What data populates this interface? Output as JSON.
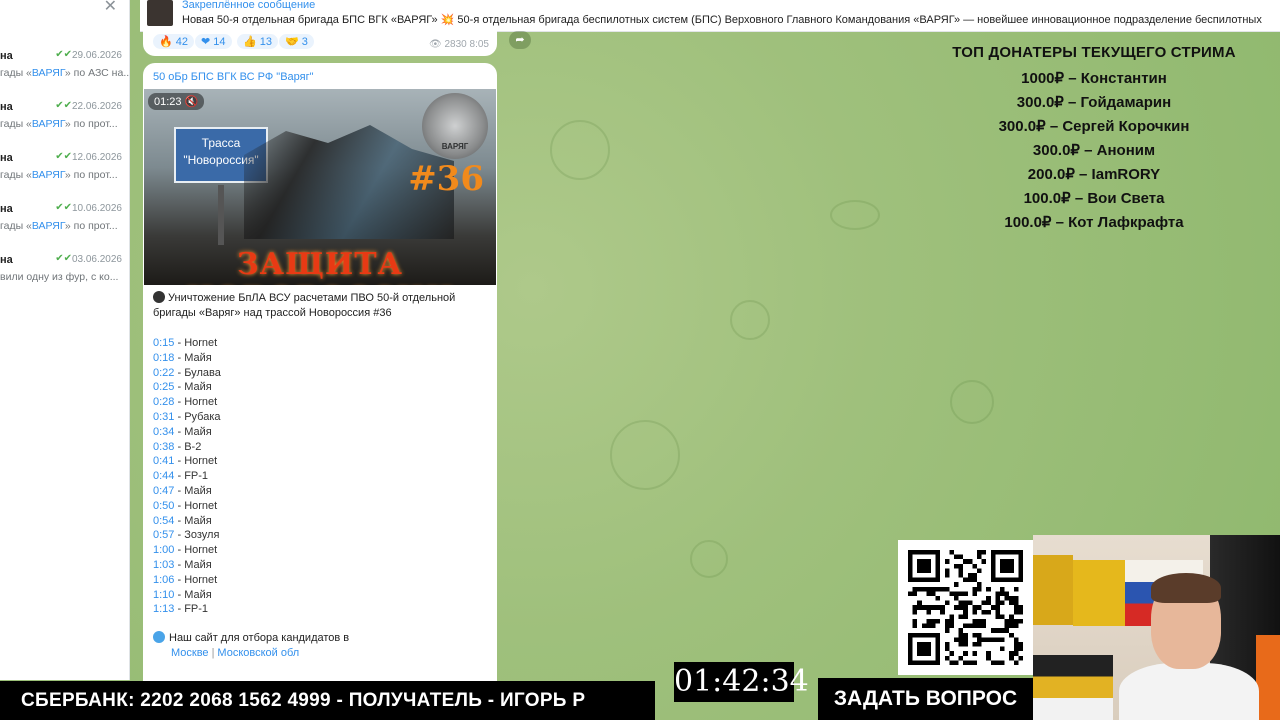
{
  "chat_list": {
    "items": [
      {
        "name": "на",
        "date": "29.06.2026",
        "preview_prefix": "гады «",
        "preview_link": "ВАРЯГ",
        "preview_suffix": "» по АЗС на..."
      },
      {
        "name": "на",
        "date": "22.06.2026",
        "preview_prefix": "гады «",
        "preview_link": "ВАРЯГ",
        "preview_suffix": "» по прот..."
      },
      {
        "name": "на",
        "date": "12.06.2026",
        "preview_prefix": "гады «",
        "preview_link": "ВАРЯГ",
        "preview_suffix": "» по прот..."
      },
      {
        "name": "на",
        "date": "10.06.2026",
        "preview_prefix": "гады «",
        "preview_link": "ВАРЯГ",
        "preview_suffix": "» по прот..."
      },
      {
        "name": "на",
        "date": "03.06.2026",
        "preview_prefix": "вили одну из фур, с ко...",
        "preview_link": "",
        "preview_suffix": ""
      }
    ]
  },
  "pinned": {
    "title": "Закреплённое сообщение",
    "text": "Новая 50-я отдельная бригада БПС ВГК «ВАРЯГ» 💥 50-я отдельная бригада беспилотных систем (БПС) Верховного Главного Командования «ВАРЯГ» — новейшее инновационное подразделение беспилотных"
  },
  "top_reactions": [
    {
      "emoji": "🔥",
      "count": "42"
    },
    {
      "emoji": "❤",
      "count": "14"
    },
    {
      "emoji": "👍",
      "count": "13"
    },
    {
      "emoji": "🤝",
      "count": "3"
    }
  ],
  "top_views": "2830",
  "top_time": "8:05",
  "message": {
    "channel": "50 оБр БПС ВГК ВС РФ \"Варяг\"",
    "video_duration": "01:23",
    "sign_text_1": "Трасса",
    "sign_text_2": "\"Новороссия\"",
    "number_badge": "#36",
    "emblem_text": "ВАРЯГ",
    "banner": "ЗАЩИТА НОВОРОССИИ",
    "caption": "Уничтожение БпЛА ВСУ расчетами ПВО 50-й отдельной бригады «Варяг» над трассой Новороссия #36",
    "timeline": [
      {
        "time": "0:15",
        "label": "Hornet"
      },
      {
        "time": "0:18",
        "label": "Майя"
      },
      {
        "time": "0:22",
        "label": "Булава"
      },
      {
        "time": "0:25",
        "label": "Майя"
      },
      {
        "time": "0:28",
        "label": "Hornet"
      },
      {
        "time": "0:31",
        "label": "Рубака"
      },
      {
        "time": "0:34",
        "label": "Майя"
      },
      {
        "time": "0:38",
        "label": "B-2"
      },
      {
        "time": "0:41",
        "label": "Hornet"
      },
      {
        "time": "0:44",
        "label": "FP-1"
      },
      {
        "time": "0:47",
        "label": "Майя"
      },
      {
        "time": "0:50",
        "label": "Hornet"
      },
      {
        "time": "0:54",
        "label": "Майя"
      },
      {
        "time": "0:57",
        "label": "Зозуля"
      },
      {
        "time": "1:00",
        "label": "Hornet"
      },
      {
        "time": "1:03",
        "label": "Майя"
      },
      {
        "time": "1:06",
        "label": "Hornet"
      },
      {
        "time": "1:10",
        "label": "Майя"
      },
      {
        "time": "1:13",
        "label": "FP-1"
      }
    ],
    "site_label": "Наш сайт для отбора кандидатов в",
    "site_link_1": "Москве",
    "site_separator": "|",
    "site_link_2": "Московской обл"
  },
  "donors": {
    "title": "ТОП ДОНАТЕРЫ ТЕКУЩЕГО СТРИМА",
    "rows": [
      "1000₽ – Константин",
      "300.0₽ – Гойдамарин",
      "300.0₽ – Сергей Корочкин",
      "300.0₽ – Аноним",
      "200.0₽ – IamRORY",
      "100.0₽ – Вои Света",
      "100.0₽ – Кот Лафкрафта"
    ]
  },
  "bank_bar": "СБЕРБАНК: 2202 2068 1562 4999 - ПОЛУЧАТЕЛЬ - ИГОРЬ Р",
  "clock": "01:42:34",
  "ask_bar": "ЗАДАТЬ ВОПРОС",
  "colors": {
    "accent": "#3390ec",
    "wallpaper": "#9bbf78",
    "banner": "#e83a14"
  }
}
